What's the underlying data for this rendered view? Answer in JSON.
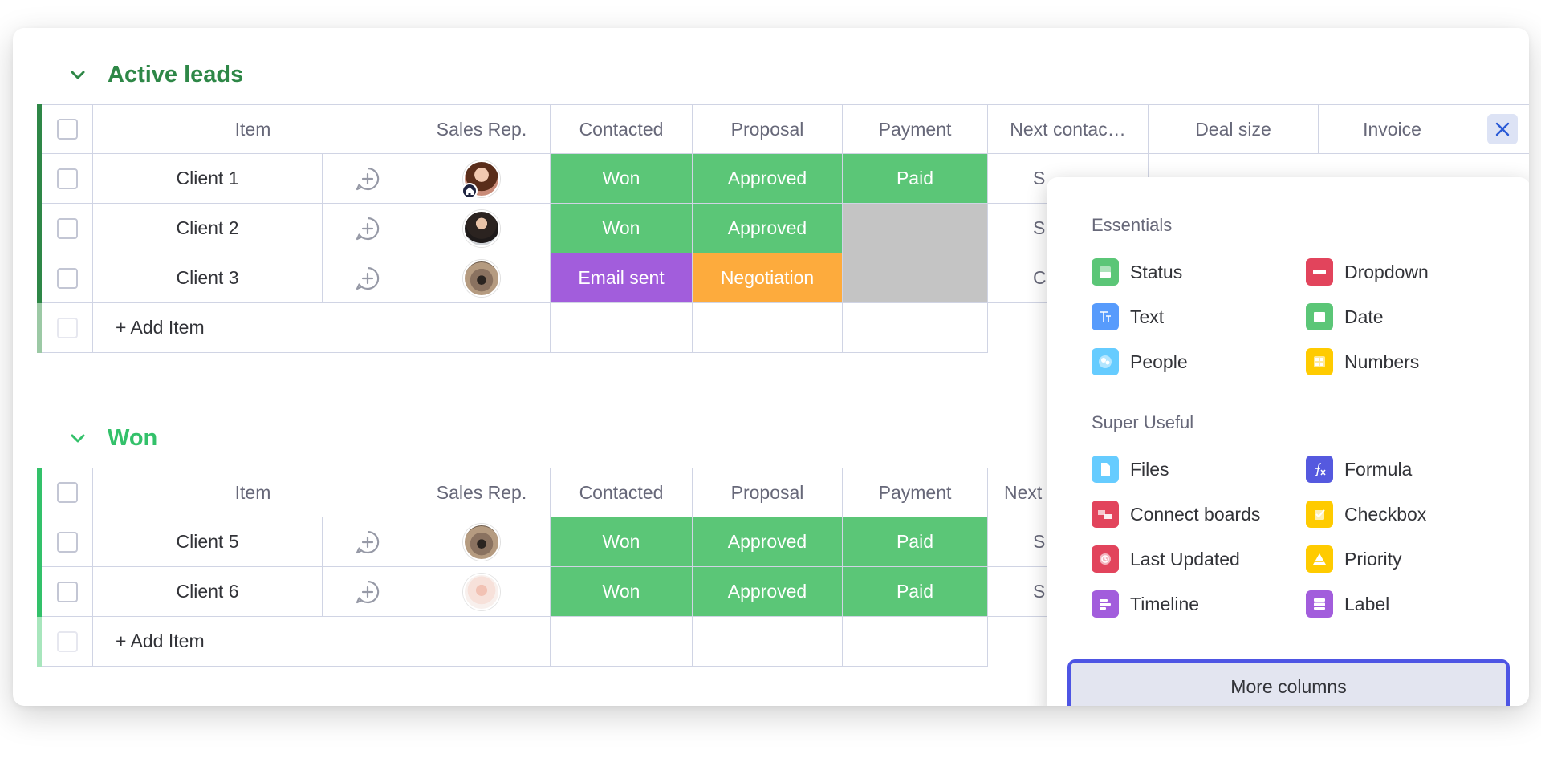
{
  "groups": [
    {
      "title": "Active leads",
      "columns": {
        "item": "Item",
        "sales_rep": "Sales Rep.",
        "contacted": "Contacted",
        "proposal": "Proposal",
        "payment": "Payment",
        "next_contact": "Next contac…",
        "deal_size": "Deal size",
        "invoice": "Invoice"
      },
      "rows": [
        {
          "name": "Client 1",
          "contacted": "Won",
          "proposal": "Approved",
          "payment": "Paid",
          "next_contact": "S"
        },
        {
          "name": "Client 2",
          "contacted": "Won",
          "proposal": "Approved",
          "payment": "",
          "next_contact": "S"
        },
        {
          "name": "Client 3",
          "contacted": "Email sent",
          "proposal": "Negotiation",
          "payment": "",
          "next_contact": "C"
        }
      ],
      "add_item": "+ Add Item"
    },
    {
      "title": "Won",
      "columns": {
        "item": "Item",
        "sales_rep": "Sales Rep.",
        "contacted": "Contacted",
        "proposal": "Proposal",
        "payment": "Payment",
        "next_contact": "Next"
      },
      "rows": [
        {
          "name": "Client 5",
          "contacted": "Won",
          "proposal": "Approved",
          "payment": "Paid",
          "next_contact": "S"
        },
        {
          "name": "Client 6",
          "contacted": "Won",
          "proposal": "Approved",
          "payment": "Paid",
          "next_contact": "S"
        }
      ],
      "add_item": "+ Add Item"
    }
  ],
  "popup": {
    "essentials_title": "Essentials",
    "essentials": [
      {
        "label": "Status",
        "icon": "status-icon",
        "color": "#5bc677"
      },
      {
        "label": "Dropdown",
        "icon": "dropdown-icon",
        "color": "#e2445c"
      },
      {
        "label": "Text",
        "icon": "text-icon",
        "color": "#579bfc"
      },
      {
        "label": "Date",
        "icon": "date-icon",
        "color": "#5bc677"
      },
      {
        "label": "People",
        "icon": "people-icon",
        "color": "#66ccff"
      },
      {
        "label": "Numbers",
        "icon": "numbers-icon",
        "color": "#ffcb00"
      }
    ],
    "super_useful_title": "Super Useful",
    "super_useful": [
      {
        "label": "Files",
        "icon": "files-icon",
        "color": "#66ccff"
      },
      {
        "label": "Formula",
        "icon": "formula-icon",
        "color": "#5559df"
      },
      {
        "label": "Connect boards",
        "icon": "connect-boards-icon",
        "color": "#e2445c"
      },
      {
        "label": "Checkbox",
        "icon": "checkbox-icon",
        "color": "#ffcb00"
      },
      {
        "label": "Last Updated",
        "icon": "last-updated-icon",
        "color": "#e2445c"
      },
      {
        "label": "Priority",
        "icon": "priority-icon",
        "color": "#ffcb00"
      },
      {
        "label": "Timeline",
        "icon": "timeline-icon",
        "color": "#a25ddc"
      },
      {
        "label": "Label",
        "icon": "label-icon",
        "color": "#a25ddc"
      }
    ],
    "more_columns": "More columns"
  },
  "status_colors": {
    "won": "#5bc677",
    "email_sent": "#a25ddc",
    "negotiation": "#fdab3d",
    "empty": "#c4c4c4"
  }
}
